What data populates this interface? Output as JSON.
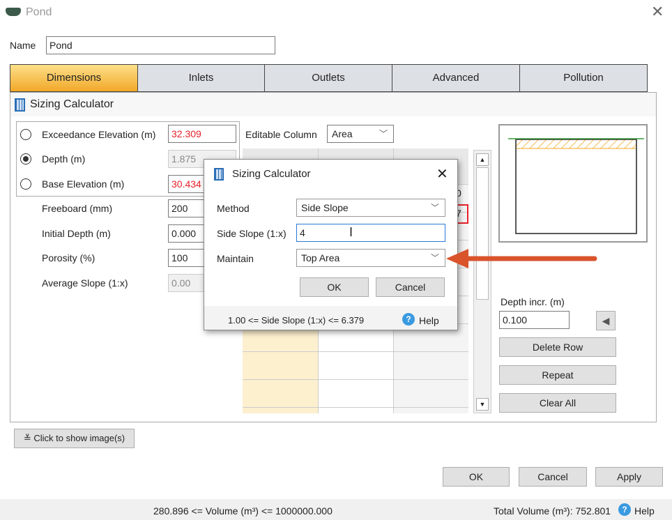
{
  "window": {
    "title": "Pond",
    "close_icon": "close-icon",
    "app_icon": "pond-icon"
  },
  "name": {
    "label": "Name",
    "value": "Pond"
  },
  "tabs": [
    {
      "label": "Dimensions",
      "active": true
    },
    {
      "label": "Inlets"
    },
    {
      "label": "Outlets"
    },
    {
      "label": "Advanced"
    },
    {
      "label": "Pollution"
    }
  ],
  "sizing_link": "Sizing Calculator",
  "fields": {
    "exceedance": {
      "label": "Exceedance Elevation (m)",
      "value": "32.309"
    },
    "depth": {
      "label": "Depth (m)",
      "value": "1.875"
    },
    "base": {
      "label": "Base Elevation (m)",
      "value": "30.434"
    },
    "freeboard": {
      "label": "Freeboard (mm)",
      "value": "200"
    },
    "initial_depth": {
      "label": "Initial Depth (m)",
      "value": "0.000"
    },
    "porosity": {
      "label": "Porosity (%)",
      "value": "100"
    },
    "avg_slope": {
      "label": "Average Slope (1:x)",
      "value": "0.00"
    }
  },
  "editable_column": {
    "label": "Editable Column",
    "value": "Area"
  },
  "table": {
    "partial_header": ")",
    "partial_cells": [
      "0",
      "7"
    ]
  },
  "depth_incr": {
    "label": "Depth incr. (m)",
    "value": "0.100"
  },
  "side_buttons": [
    "Delete Row",
    "Repeat",
    "Clear All"
  ],
  "show_images": "Click to show image(s)",
  "footer": {
    "ok": "OK",
    "cancel": "Cancel",
    "apply": "Apply",
    "volume_range": "280.896 <= Volume (m³) <= 1000000.000",
    "total_volume": "Total Volume (m³): 752.801",
    "help": "Help"
  },
  "dialog": {
    "title": "Sizing Calculator",
    "method_label": "Method",
    "method_value": "Side Slope",
    "slope_label": "Side Slope (1:x)",
    "slope_value": "4",
    "maintain_label": "Maintain",
    "maintain_value": "Top Area",
    "ok": "OK",
    "cancel": "Cancel",
    "range": "1.00 <= Side Slope (1:x) <= 6.379",
    "help": "Help"
  },
  "colors": {
    "active_tab": "#f5b840",
    "error_text": "#e8202a",
    "arrow": "#d9532b",
    "hatch": "#f5a623",
    "ground": "#3a9a3a"
  }
}
